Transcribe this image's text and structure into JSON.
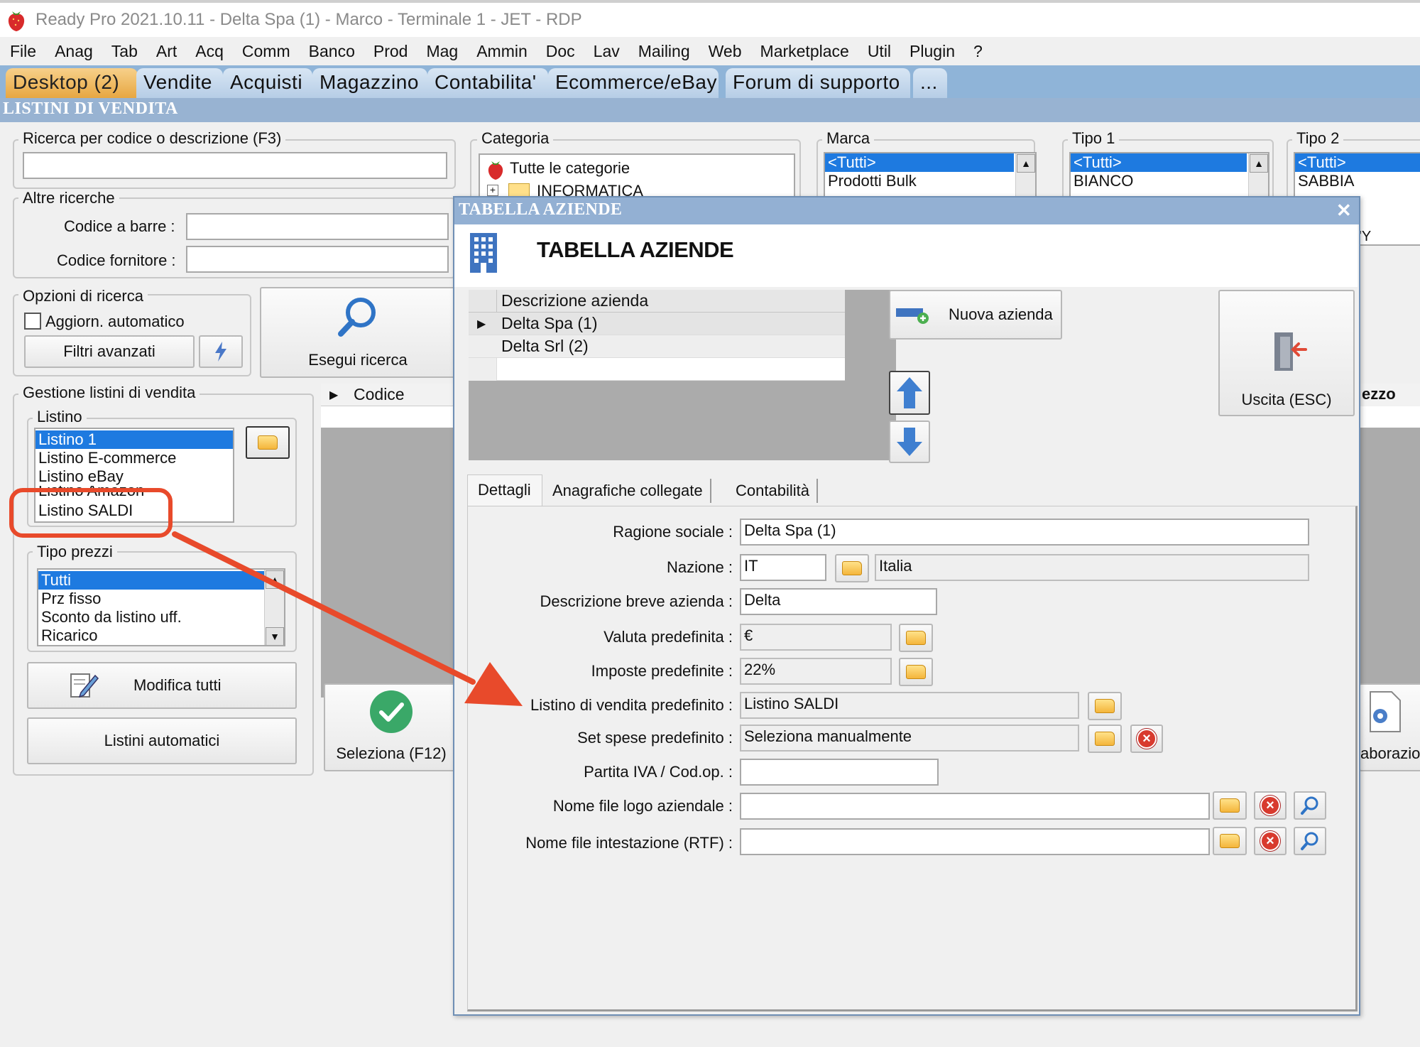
{
  "window": {
    "title": "Ready Pro 2021.10.11 - Delta Spa (1) - Marco - Terminale 1 - JET - RDP"
  },
  "menu": [
    "File",
    "Anag",
    "Tab",
    "Art",
    "Acq",
    "Comm",
    "Banco",
    "Prod",
    "Mag",
    "Ammin",
    "Doc",
    "Lav",
    "Mailing",
    "Web",
    "Marketplace",
    "Util",
    "Plugin",
    "?"
  ],
  "tabs": [
    "Desktop (2)",
    "Vendite",
    "Acquisti",
    "Magazzino",
    "Contabilita'",
    "Ecommerce/eBay",
    "Forum di supporto",
    "..."
  ],
  "section_title": "LISTINI DI VENDITA",
  "left": {
    "search_label": "Ricerca per codice o descrizione (F3)",
    "search_value": "",
    "altre_label": "Altre ricerche",
    "barcode_label": "Codice a barre :",
    "supplier_label": "Codice fornitore :",
    "opzioni_label": "Opzioni di ricerca",
    "auto_update_label": "Aggiorn. automatico",
    "filtri_label": "Filtri avanzati",
    "esegui_label": "Esegui ricerca",
    "gestione_label": "Gestione listini di vendita",
    "listino_label": "Listino",
    "listini": [
      "Listino 1",
      "Listino E-commerce",
      "Listino eBay",
      "Listino Amazon",
      "Listino SALDI"
    ],
    "tipo_prezzi_label": "Tipo prezzi",
    "tipo_prezzi": [
      "Tutti",
      "Prz fisso",
      "Sconto da listino uff.",
      "Ricarico"
    ],
    "modifica_label": "Modifica tutti",
    "automatici_label": "Listini automatici"
  },
  "filters": {
    "categoria_label": "Categoria",
    "categorie": [
      "Tutte le categorie",
      "INFORMATICA"
    ],
    "marca_label": "Marca",
    "marche": [
      "<Tutti>",
      "Prodotti Bulk"
    ],
    "tipo1_label": "Tipo 1",
    "tipo1": [
      "<Tutti>",
      "BIANCO"
    ],
    "tipo2_label": "Tipo 2",
    "tipo2": [
      "<Tutti>",
      "SABBIA"
    ],
    "tipo2_fragment": "'Y"
  },
  "background_grid": {
    "codice_header": "Codice",
    "prezzo_fragment": "ezzo",
    "seleziona_label": "Seleziona (F12)",
    "elaborazioni_fragment": "aborazion"
  },
  "dialog": {
    "titlebar": "TABELLA AZIENDE",
    "close": "✕",
    "heading": "TABELLA AZIENDE",
    "grid_header": "Descrizione azienda",
    "aziende": [
      "Delta Spa (1)",
      "Delta Srl (2)"
    ],
    "nuova_label": "Nuova azienda",
    "uscita_label": "Uscita (ESC)",
    "tabs": [
      "Dettagli",
      "Anagrafiche collegate",
      "Contabilità"
    ],
    "fields": {
      "ragione_sociale_label": "Ragione sociale :",
      "ragione_sociale": "Delta Spa (1)",
      "nazione_label": "Nazione :",
      "nazione_code": "IT",
      "nazione_name": "Italia",
      "descr_breve_label": "Descrizione breve azienda :",
      "descr_breve": "Delta",
      "valuta_label": "Valuta predefinita :",
      "valuta": "€",
      "imposte_label": "Imposte predefinite :",
      "imposte": "22%",
      "listino_label": "Listino di vendita predefinito :",
      "listino": "Listino SALDI",
      "spese_label": "Set spese predefinito :",
      "spese": "Seleziona manualmente",
      "piva_label": "Partita IVA / Cod.op. :",
      "piva": "",
      "logo_label": "Nome file logo aziendale :",
      "logo": "",
      "intestazione_label": "Nome file intestazione (RTF) :",
      "intestazione": ""
    }
  },
  "colors": {
    "selection": "#1e7ae0",
    "annotation": "#e84a2b",
    "active_tab": "#e7a742",
    "tab_strip": "#8fb4d8"
  }
}
